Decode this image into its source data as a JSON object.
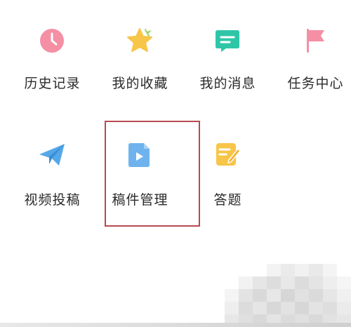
{
  "menu": {
    "items": [
      {
        "label": "历史记录",
        "icon": "clock-icon",
        "color": "#f48fa4"
      },
      {
        "label": "我的收藏",
        "icon": "star-icon",
        "color": "#f7c548"
      },
      {
        "label": "我的消息",
        "icon": "message-icon",
        "color": "#2fc6a8"
      },
      {
        "label": "任务中心",
        "icon": "flag-icon",
        "color": "#f48fa4"
      },
      {
        "label": "视频投稿",
        "icon": "paper-plane-icon",
        "color": "#55a8e8"
      },
      {
        "label": "稿件管理",
        "icon": "video-file-icon",
        "color": "#6fb3ee"
      },
      {
        "label": "答题",
        "icon": "edit-note-icon",
        "color": "#f7c548"
      }
    ],
    "highlight_color": "#b84a50"
  }
}
